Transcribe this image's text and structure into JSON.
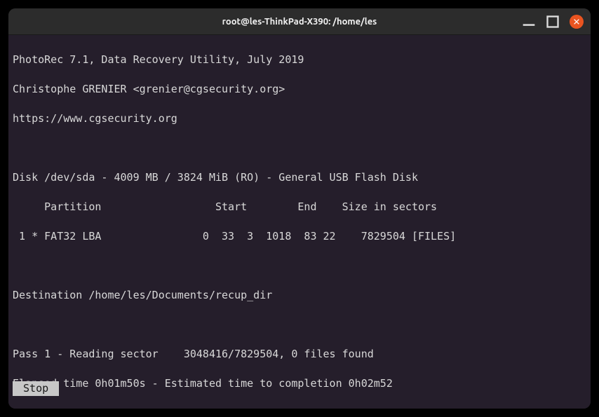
{
  "window": {
    "title": "root@les-ThinkPad-X390: /home/les"
  },
  "header": {
    "app_line": "PhotoRec 7.1, Data Recovery Utility, July 2019",
    "author_line": "Christophe GRENIER <grenier@cgsecurity.org>",
    "url_line": "https://www.cgsecurity.org"
  },
  "disk": {
    "disk_line": "Disk /dev/sda - 4009 MB / 3824 MiB (RO) - General USB Flash Disk",
    "header_line": "     Partition                  Start        End    Size in sectors",
    "partition_line": " 1 * FAT32 LBA                0  33  3  1018  83 22    7829504 [FILES]"
  },
  "destination_line": "Destination /home/les/Documents/recup_dir",
  "progress": {
    "pass_line": "Pass 1 - Reading sector    3048416/7829504, 0 files found",
    "time_line": "Elapsed time 0h01m50s - Estimated time to completion 0h02m52"
  },
  "stop_label": " Stop "
}
